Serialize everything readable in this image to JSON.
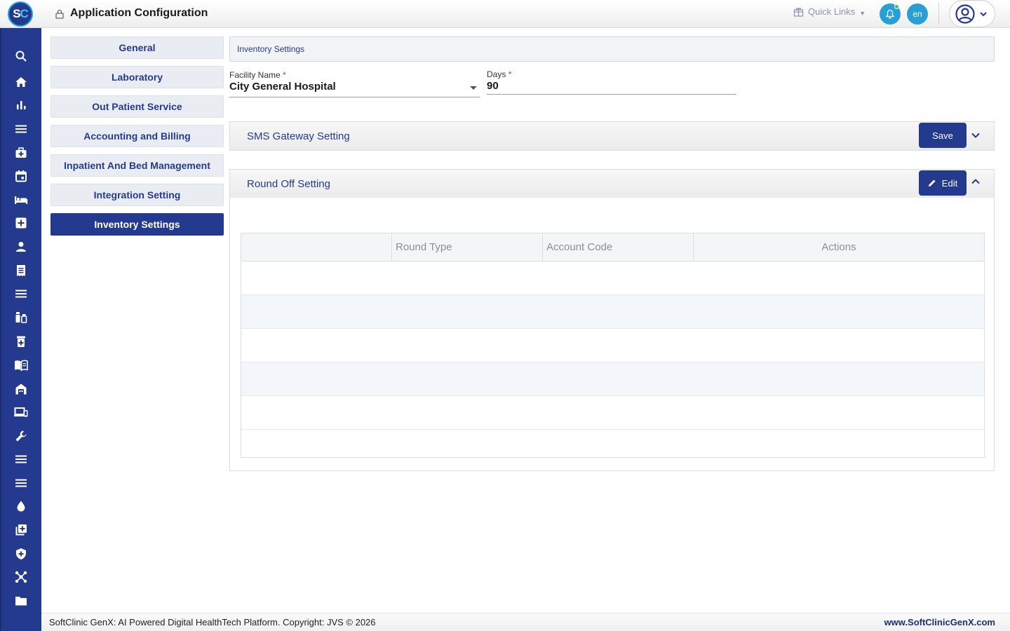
{
  "header": {
    "logo": {
      "s": "S",
      "c": "C"
    },
    "title": "Application Configuration",
    "quick_links": "Quick Links",
    "language": "en"
  },
  "sidebar_icons": [
    "search-icon",
    "home-icon",
    "bar-chart-icon",
    "menu-icon",
    "medical-bag-icon",
    "calendar-icon",
    "bed-icon",
    "plus-box-icon",
    "person-icon",
    "receipt-icon",
    "list-icon",
    "medication-icon",
    "pill-bottle-icon",
    "book-icon",
    "store-icon",
    "devices-icon",
    "wrench-icon",
    "list-alt-icon",
    "list-lines-icon",
    "drop-icon",
    "add-library-icon",
    "shield-icon",
    "hub-icon",
    "folder-icon"
  ],
  "menu": {
    "items": [
      "General",
      "Laboratory",
      "Out Patient Service",
      "Accounting and Billing",
      "Inpatient And Bed Management",
      "Integration Setting",
      "Inventory Settings"
    ],
    "active": "Inventory Settings"
  },
  "main": {
    "section_title": "Inventory Settings",
    "facility": {
      "label": "Facility Name",
      "required": "*",
      "value": "City General Hospital"
    },
    "days": {
      "label": "Days",
      "required": "*",
      "value": "90"
    },
    "sms_panel": {
      "title": "SMS Gateway Setting",
      "save_label": "Save"
    },
    "roundoff_panel": {
      "title": "Round Off Setting",
      "edit_label": "Edit"
    },
    "table": {
      "columns": [
        "",
        "Round Type",
        "Account Code",
        "Actions"
      ]
    }
  },
  "footer": {
    "copyright": "SoftClinic GenX: AI Powered Digital HealthTech Platform. Copyright: JVS © 2026",
    "website": "www.SoftClinicGenX.com"
  },
  "colors": {
    "primary": "#243a8f",
    "accent": "#2a9fd6",
    "background": "#ffffff"
  }
}
